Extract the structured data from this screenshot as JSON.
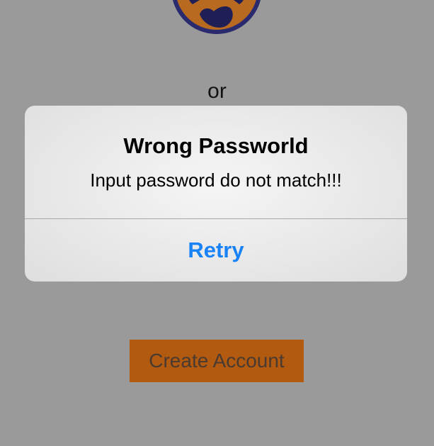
{
  "login": {
    "or_label": "or",
    "create_account_label": "Create Account"
  },
  "alert": {
    "title": "Wrong Passworld",
    "message": "Input password do not match!!!",
    "retry_label": "Retry"
  },
  "colors": {
    "overlay_background": "#9a9a9a",
    "create_account_button": "#b15a10",
    "alert_action": "#1a82f7",
    "logo_ring": "#2a2a6e",
    "logo_fill": "#b86a20"
  },
  "icons": {
    "logo": "paw-logo-icon"
  }
}
